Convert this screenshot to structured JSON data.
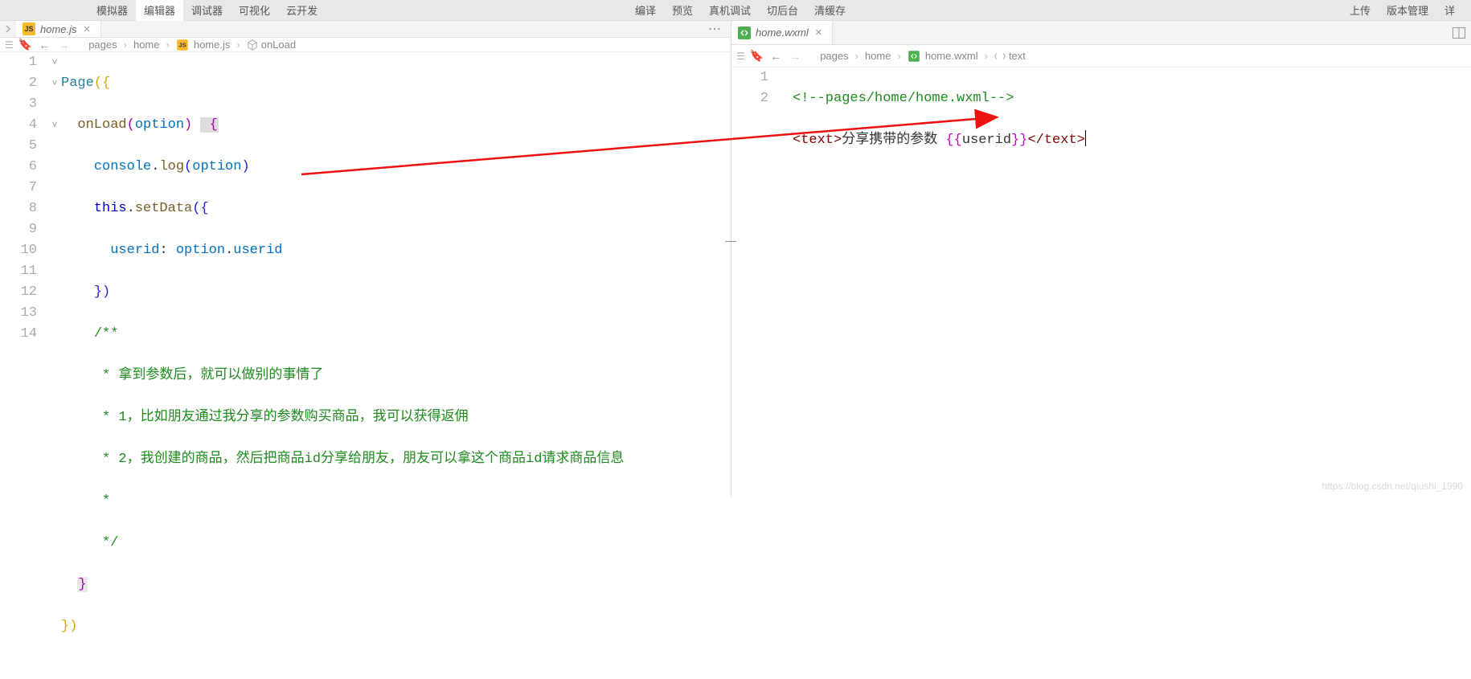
{
  "menus": {
    "left": [
      "模拟器",
      "编辑器",
      "调试器",
      "可视化",
      "云开发"
    ],
    "left_active_index": 1,
    "center": [
      "编译",
      "预览",
      "真机调试",
      "切后台",
      "清缓存"
    ],
    "right": [
      "上传",
      "版本管理",
      "详"
    ]
  },
  "left_pane": {
    "tab": {
      "filename": "home.js"
    },
    "breadcrumb": [
      "pages",
      "home",
      "home.js",
      "onLoad"
    ],
    "lines": [
      "1",
      "2",
      "3",
      "4",
      "5",
      "6",
      "7",
      "8",
      "9",
      "10",
      "11",
      "12",
      "13",
      "14"
    ],
    "code": {
      "l1": {
        "page": "Page",
        "open": "({"
      },
      "l2": {
        "fn": "onLoad",
        "open": "(",
        "param": "option",
        "close": ")",
        "brace": " {"
      },
      "l3": {
        "obj": "console",
        "dot": ".",
        "fn": "log",
        "open": "(",
        "arg": "option",
        "close": ")"
      },
      "l4": {
        "this": "this",
        "dot": ".",
        "fn": "setData",
        "open": "({"
      },
      "l5": {
        "key": "userid",
        "colon": ": ",
        "val1": "option",
        "dot": ".",
        "val2": "userid"
      },
      "l6": {
        "close": "})"
      },
      "l7": {
        "c": "/**"
      },
      "l8": {
        "c": " * 拿到参数后，就可以做别的事情了"
      },
      "l9": {
        "c": " * 1，比如朋友通过我分享的参数购买商品，我可以获得返佣"
      },
      "l10": {
        "c": " * 2，我创建的商品，然后把商品id分享给朋友，朋友可以拿这个商品id请求商品信息"
      },
      "l11": {
        "c": " *"
      },
      "l12": {
        "c": " */"
      },
      "l13": {
        "brace": "}"
      },
      "l14": {
        "close": "})"
      }
    }
  },
  "right_pane": {
    "tab": {
      "filename": "home.wxml"
    },
    "breadcrumb": [
      "pages",
      "home",
      "home.wxml",
      "text"
    ],
    "lines": [
      "1",
      "2"
    ],
    "code": {
      "l1": {
        "c": "<!--pages/home/home.wxml-->"
      },
      "l2": {
        "open_tag": "<text>",
        "text": "分享携带的参数 ",
        "mustache_open": "{{",
        "mustache_var": "userid",
        "mustache_close": "}}",
        "close_tag": "</text>"
      }
    }
  },
  "watermark": "https://blog.csdn.net/qiushi_1990"
}
